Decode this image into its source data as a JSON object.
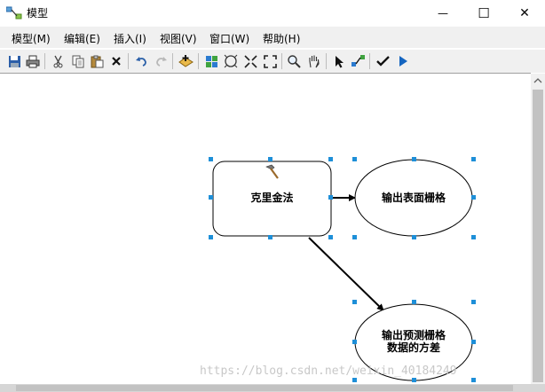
{
  "window": {
    "title": "模型",
    "minimize": "—",
    "maximize": "☐",
    "close": "✕"
  },
  "menu": [
    {
      "label": "模型(M)"
    },
    {
      "label": "编辑(E)"
    },
    {
      "label": "插入(I)"
    },
    {
      "label": "视图(V)"
    },
    {
      "label": "窗口(W)"
    },
    {
      "label": "帮助(H)"
    }
  ],
  "toolbar_icons": [
    "save-icon",
    "print-icon",
    "cut-icon",
    "copy-icon",
    "paste-icon",
    "delete-icon",
    "undo-icon",
    "redo-icon",
    "add-data-icon",
    "auto-layout-icon",
    "full-extent-icon",
    "zoom-in-fixed-icon",
    "zoom-out-fixed-icon",
    "zoom-icon",
    "pan-icon",
    "select-icon",
    "connect-icon",
    "validate-icon",
    "run-icon"
  ],
  "model": {
    "tool": {
      "label": "克里金法",
      "icon": "hammer-icon"
    },
    "output1": {
      "label": "输出表面栅格"
    },
    "output2": {
      "line1": "输出预测栅格",
      "line2": "数据的方差"
    }
  },
  "watermark": "https://blog.csdn.net/weixin_40184249",
  "colors": {
    "handle": "#1e8fd8",
    "run": "#1565c0",
    "menu_bg": "#f0f0f0"
  }
}
